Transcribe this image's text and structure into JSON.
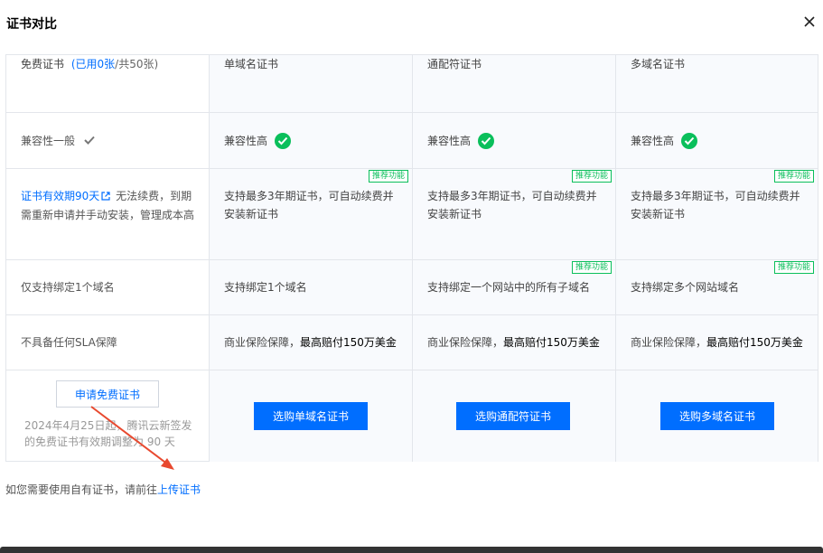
{
  "modal": {
    "title": "证书对比",
    "close_icon": "close-icon"
  },
  "columns": {
    "free": {
      "label": "免费证书",
      "quota_used": "(已用0张",
      "quota_total": "/共50张)"
    },
    "single": {
      "label": "单域名证书"
    },
    "wildcard": {
      "label": "通配符证书"
    },
    "multi": {
      "label": "多域名证书"
    }
  },
  "rows": {
    "compat": {
      "free": "兼容性一般",
      "single": "兼容性高",
      "wildcard": "兼容性高",
      "multi": "兼容性高"
    },
    "validity": {
      "free_link": "证书有效期90天",
      "free_text": "无法续费，到期需重新申请并手动安装，管理成本高",
      "paid": "支持最多3年期证书，可自动续费并安装新证书",
      "badge": "推荐功能"
    },
    "domain": {
      "free": "仅支持绑定1个域名",
      "single": "支持绑定1个域名",
      "wildcard": "支持绑定一个网站中的所有子域名",
      "multi": "支持绑定多个网站域名",
      "badge": "推荐功能"
    },
    "sla": {
      "free": "不具备任何SLA保障",
      "paid_prefix": "商业保险保障，",
      "paid_strong": "最高赔付150万美金"
    }
  },
  "actions": {
    "apply_free": "申请免费证书",
    "apply_note": "2024年4月25日起，腾讯云新签发的免费证书有效期调整为 90 天",
    "buy_single": "选购单域名证书",
    "buy_wildcard": "选购通配符证书",
    "buy_multi": "选购多域名证书"
  },
  "footer": {
    "prefix": "如您需要使用自有证书，请前往",
    "link": "上传证书"
  },
  "colors": {
    "accent": "#006eff",
    "success": "#0abf5b",
    "annotation_arrow": "#e8492f"
  }
}
